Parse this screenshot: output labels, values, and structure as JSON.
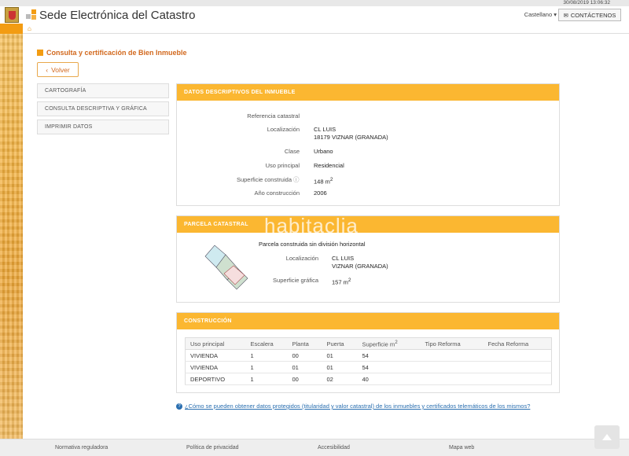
{
  "topbar": {
    "timestamp": "30/08/2019  13:06:32"
  },
  "header": {
    "title": "Sede Electrónica del Catastro",
    "language": "Castellano",
    "contact_label": "CONTÁCTENOS"
  },
  "page": {
    "title": "Consulta y certificación de Bien Inmueble",
    "back_label": "Volver"
  },
  "sidebar": {
    "items": [
      {
        "label": "CARTOGRAFÍA"
      },
      {
        "label": "CONSULTA DESCRIPTIVA Y GRÁFICA"
      },
      {
        "label": "IMPRIMIR DATOS"
      }
    ]
  },
  "descriptivos": {
    "heading": "DATOS DESCRIPTIVOS DEL INMUEBLE",
    "ref_label": "Referencia catastral",
    "loc_label": "Localización",
    "loc_line1": "CL LUIS",
    "loc_line2": "18179 VIZNAR (GRANADA)",
    "clase_label": "Clase",
    "clase_value": "Urbano",
    "uso_label": "Uso principal",
    "uso_value": "Residencial",
    "sup_label": "Superficie construida",
    "sup_value": "148 m",
    "anio_label": "Año construcción",
    "anio_value": "2006"
  },
  "parcela": {
    "heading": "PARCELA CATASTRAL",
    "subtitle": "Parcela construida sin división horizontal",
    "loc_label": "Localización",
    "loc_line1": "CL LUIS",
    "loc_line2": "VIZNAR (GRANADA)",
    "sup_label": "Superficie gráfica",
    "sup_value": "157 m"
  },
  "construccion": {
    "heading": "CONSTRUCCIÓN",
    "columns": [
      "Uso principal",
      "Escalera",
      "Planta",
      "Puerta",
      "Superficie m",
      "Tipo Reforma",
      "Fecha Reforma"
    ],
    "rows": [
      [
        "VIVIENDA",
        "1",
        "00",
        "01",
        "54",
        "",
        ""
      ],
      [
        "VIVIENDA",
        "1",
        "01",
        "01",
        "54",
        "",
        ""
      ],
      [
        "DEPORTIVO",
        "1",
        "00",
        "02",
        "40",
        "",
        ""
      ]
    ]
  },
  "help_link": "¿Cómo se pueden obtener datos protegidos (titularidad y valor catastral) de los inmuebles y certificados telemáticos de los mismos?",
  "watermark": "habitaclia",
  "footer": {
    "links": [
      "Normativa reguladora",
      "Política de privacidad",
      "Accesibilidad",
      "Mapa web"
    ]
  },
  "colors": {
    "accent": "#f39c12",
    "panel_header": "#fbb731",
    "title": "#d2691e",
    "link": "#2a6fb0"
  }
}
